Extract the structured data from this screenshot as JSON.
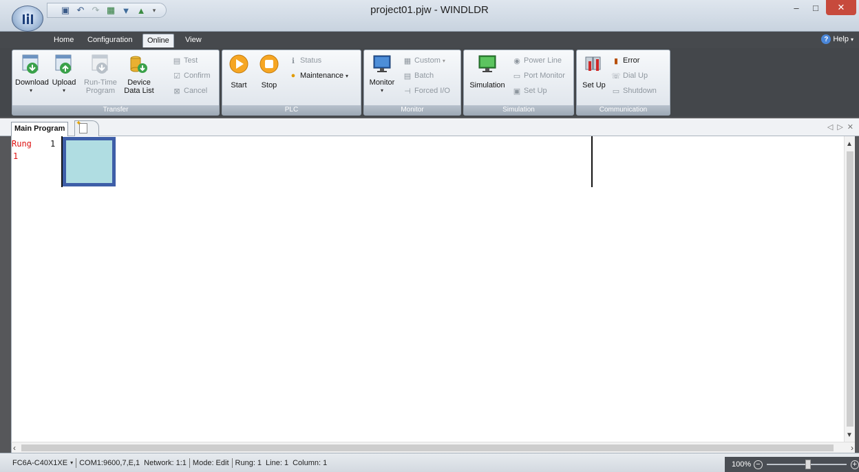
{
  "window": {
    "title": "project01.pjw - WINDLDR",
    "minimize": "–",
    "maximize": "□",
    "close": "✕"
  },
  "quick_access": [
    "save-icon",
    "undo-icon",
    "redo-icon",
    "plc-type-icon",
    "download-icon",
    "upload-icon"
  ],
  "ribbon_tabs": [
    {
      "label": "Home"
    },
    {
      "label": "Configuration"
    },
    {
      "label": "Online"
    },
    {
      "label": "View"
    }
  ],
  "help_label": "Help",
  "groups": {
    "transfer": {
      "label": "Transfer",
      "download": "Download",
      "upload": "Upload",
      "runtime_line1": "Run-Time",
      "runtime_line2": "Program",
      "device_line1": "Device",
      "device_line2": "Data List",
      "test": "Test",
      "confirm": "Confirm",
      "cancel": "Cancel"
    },
    "plc": {
      "label": "PLC",
      "start": "Start",
      "stop": "Stop",
      "status": "Status",
      "maintenance": "Maintenance"
    },
    "monitor": {
      "label": "Monitor",
      "monitor": "Monitor",
      "custom": "Custom",
      "batch": "Batch",
      "forced_io": "Forced I/O"
    },
    "simulation": {
      "label": "Simulation",
      "simulation": "Simulation",
      "power_line": "Power Line",
      "port_monitor": "Port Monitor",
      "set_up": "Set Up"
    },
    "communication": {
      "label": "Communication",
      "set_up": "Set Up",
      "error": "Error",
      "dial_up": "Dial Up",
      "shutdown": "Shutdown"
    }
  },
  "document": {
    "tab": "Main Program",
    "nav": [
      "◁",
      "▷",
      "✕"
    ]
  },
  "editor": {
    "rung_word": "Rung",
    "rung_number": "1",
    "rung_index": "1"
  },
  "status": {
    "plc_type": "FC6A-C40X1XE",
    "comm": "COM1:9600,7,E,1",
    "network": "Network: 1:1",
    "mode": "Mode: Edit",
    "rung": "Rung: 1",
    "line": "Line: 1",
    "column": "Column: 1",
    "zoom": "100%"
  }
}
